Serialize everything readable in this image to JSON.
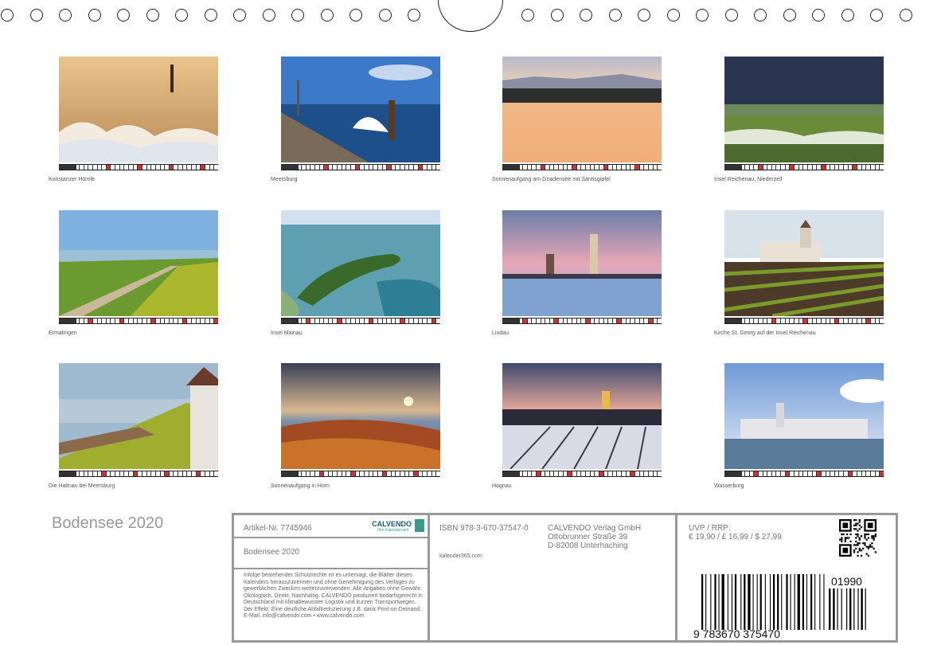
{
  "months": [
    {
      "caption": "Konstanzer Hörnle"
    },
    {
      "caption": "Meersburg"
    },
    {
      "caption": "Sonnenaufgang am Gnadensee mit Säntisgipfel"
    },
    {
      "caption": "Insel Reichenau, Niederzell"
    },
    {
      "caption": "Ermatingen"
    },
    {
      "caption": "Insel Mainau"
    },
    {
      "caption": "Lindau"
    },
    {
      "caption": "Kirche St. Georg auf der Insel Reichenau"
    },
    {
      "caption": "Die Haltnau bei Meersburg"
    },
    {
      "caption": "Sonnenaufgang in Horn"
    },
    {
      "caption": "Hagnau"
    },
    {
      "caption": "Wasserburg"
    }
  ],
  "title": "Bodensee 2020",
  "info": {
    "article": "Artikel-Nr. 7745946",
    "logo": "CALVENDO",
    "logo_sub": "Ihre Kalenderwelt",
    "calendar_title": "Bodensee 2020",
    "legal": "Infolge bestehender Schutzrechte ist es untersagt, die Blätter dieses Kalenders herauszutrennen und ohne Genehmigung des Verlages zu gewerblichen Zwecken weiterzuverwenden. Alle Angaben ohne Gewähr. Ökologisch. Direkt. Nachhaltig. CALVENDO produziert bedarfsgerecht in Deutschland mit klimabewusster Logistik und kurzen Transportwegen. Der Effekt: Eine deutliche Abfallreduzierung z.B. dank Print-on-Demand. E-Mail: info@calvendo.com • www.calvendo.com",
    "isbn": "ISBN 978-3-670-37547-0",
    "publisher_name": "CALVENDO Verlag GmbH",
    "publisher_street": "Ottobrunner Straße 39",
    "publisher_city": "D-82008 Unterhaching",
    "website": "kalender365.com",
    "uvp_label": "UVP / RRP:",
    "uvp_price": "€ 19,90 / £ 16,99 / $ 27,99",
    "barcode_digits": "9   783670   375470",
    "barcode_addon": "01990"
  }
}
